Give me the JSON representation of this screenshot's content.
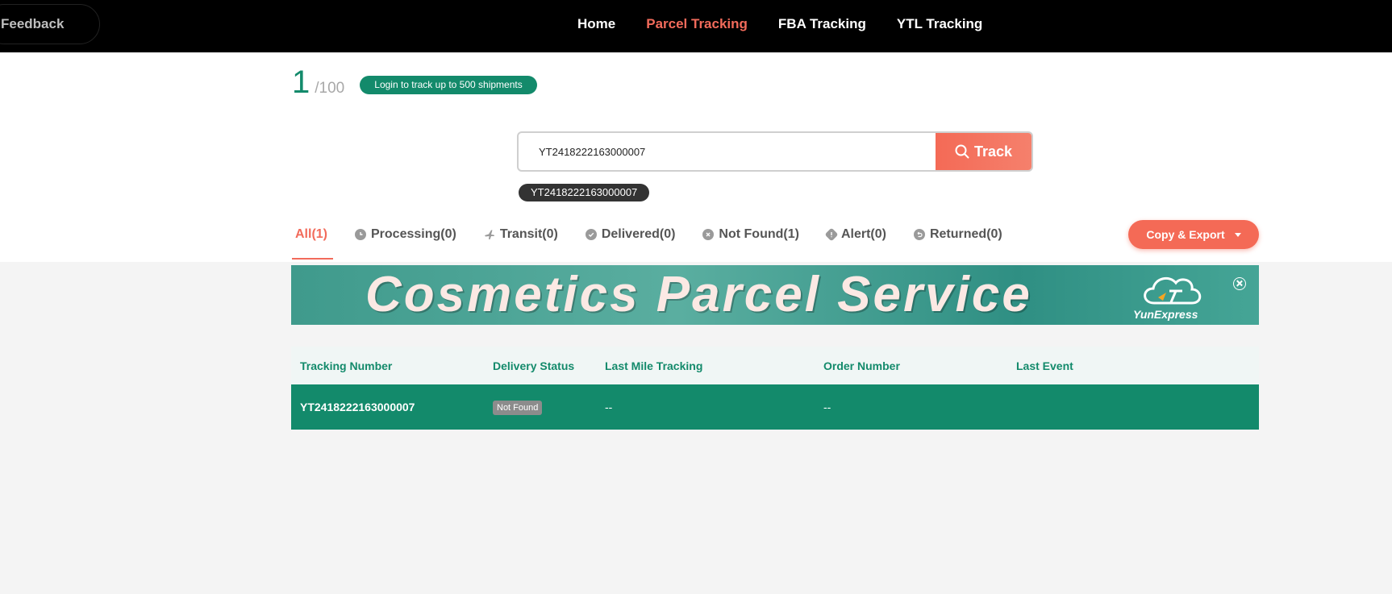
{
  "nav": {
    "feedback": "Feedback",
    "items": [
      {
        "label": "Home",
        "active": false
      },
      {
        "label": "Parcel Tracking",
        "active": true
      },
      {
        "label": "FBA Tracking",
        "active": false
      },
      {
        "label": "YTL Tracking",
        "active": false
      }
    ]
  },
  "quota": {
    "used": "1",
    "total": "/100",
    "login_label": "Login to track up to 500 shipments"
  },
  "search": {
    "value": "YT2418222163000007",
    "button_label": "Track",
    "chip": "YT2418222163000007"
  },
  "tabs": [
    {
      "label": "All(1)",
      "icon": "none",
      "active": true
    },
    {
      "label": "Processing(0)",
      "icon": "clock-icon"
    },
    {
      "label": "Transit(0)",
      "icon": "plane-icon"
    },
    {
      "label": "Delivered(0)",
      "icon": "check-icon"
    },
    {
      "label": "Not Found(1)",
      "icon": "x-icon"
    },
    {
      "label": "Alert(0)",
      "icon": "alert-icon"
    },
    {
      "label": "Returned(0)",
      "icon": "return-icon"
    }
  ],
  "export_label": "Copy & Export",
  "banner": {
    "headline": "Cosmetics Parcel Service",
    "logo_text": "YunExpress"
  },
  "table": {
    "headers": [
      "Tracking Number",
      "Delivery Status",
      "Last Mile Tracking",
      "Order Number",
      "Last Event"
    ],
    "rows": [
      {
        "tracking": "YT2418222163000007",
        "status": "Not Found",
        "last_mile": "--",
        "order": "--",
        "last_event": ""
      }
    ]
  },
  "colors": {
    "brand_green": "#138a6b",
    "accent_red": "#f26b5b"
  }
}
